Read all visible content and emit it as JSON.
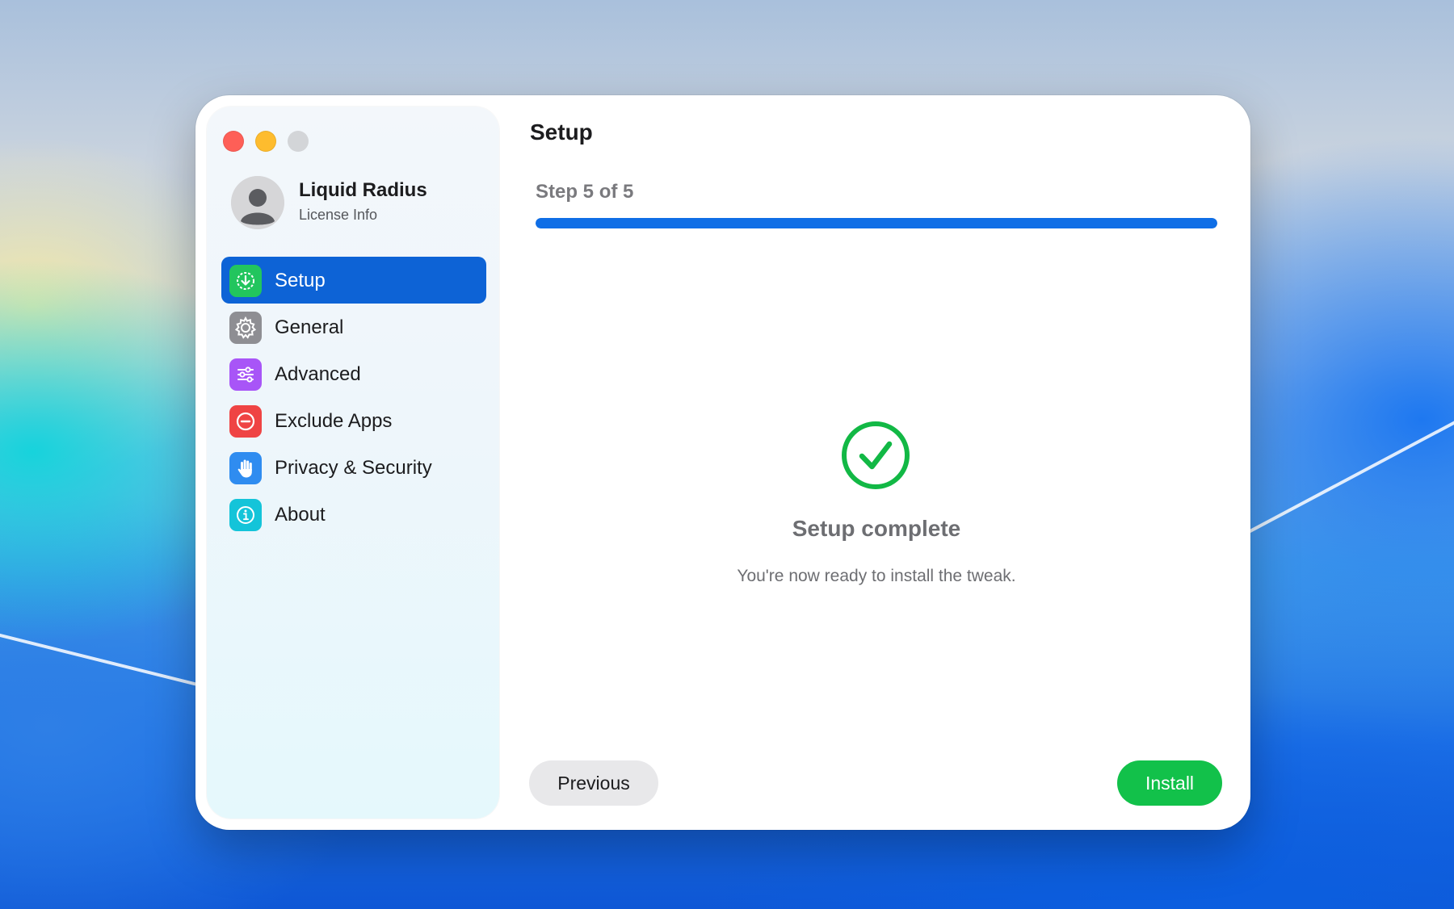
{
  "window": {
    "title": "Setup"
  },
  "profile": {
    "name": "Liquid Radius",
    "subtitle": "License Info",
    "icon": "person-avatar-icon"
  },
  "sidebar": {
    "items": [
      {
        "label": "Setup",
        "icon": "setup-download-icon",
        "color": "#22c55e",
        "active": true
      },
      {
        "label": "General",
        "icon": "gear-icon",
        "color": "#8e8e93",
        "active": false
      },
      {
        "label": "Advanced",
        "icon": "sliders-icon",
        "color": "#a855f7",
        "active": false
      },
      {
        "label": "Exclude Apps",
        "icon": "minus-circle-icon",
        "color": "#ef4444",
        "active": false
      },
      {
        "label": "Privacy & Security",
        "icon": "hand-icon",
        "color": "#2f8cf0",
        "active": false
      },
      {
        "label": "About",
        "icon": "info-icon",
        "color": "#14c4d9",
        "active": false
      }
    ]
  },
  "setup": {
    "step_label": "Step 5 of 5",
    "progress": 1.0,
    "progress_color": "#0f6ee6",
    "status_icon": "checkmark-circle-icon",
    "status_color": "#12b845",
    "complete_title": "Setup complete",
    "complete_message": "You're now ready to install the tweak."
  },
  "buttons": {
    "previous": "Previous",
    "install": "Install",
    "install_color": "#12c14a"
  }
}
